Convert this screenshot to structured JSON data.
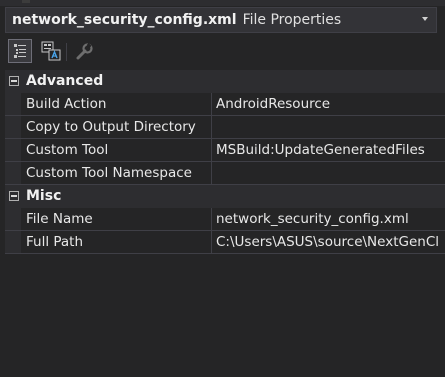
{
  "selector": {
    "object_name": "network_security_config.xml",
    "object_type": "File Properties"
  },
  "toolbar": {
    "buttons": [
      {
        "icon": "categorized-icon",
        "active": true
      },
      {
        "icon": "alphabetical-icon",
        "active": false
      },
      {
        "icon": "property-pages-icon",
        "active": false
      }
    ]
  },
  "categories": [
    {
      "label": "Advanced",
      "expanded": true,
      "properties": [
        {
          "name": "Build Action",
          "value": "AndroidResource"
        },
        {
          "name": "Copy to Output Directory",
          "value": ""
        },
        {
          "name": "Custom Tool",
          "value": "MSBuild:UpdateGeneratedFiles"
        },
        {
          "name": "Custom Tool Namespace",
          "value": ""
        }
      ]
    },
    {
      "label": "Misc",
      "expanded": true,
      "properties": [
        {
          "name": "File Name",
          "value": "network_security_config.xml"
        },
        {
          "name": "Full Path",
          "value": "C:\\Users\\ASUS\\source\\NextGenCl"
        }
      ]
    }
  ],
  "colors": {
    "background": "#252526",
    "category_bg": "#2d2d30",
    "grid_line": "#3f3f46",
    "text": "#e8e8e8"
  }
}
